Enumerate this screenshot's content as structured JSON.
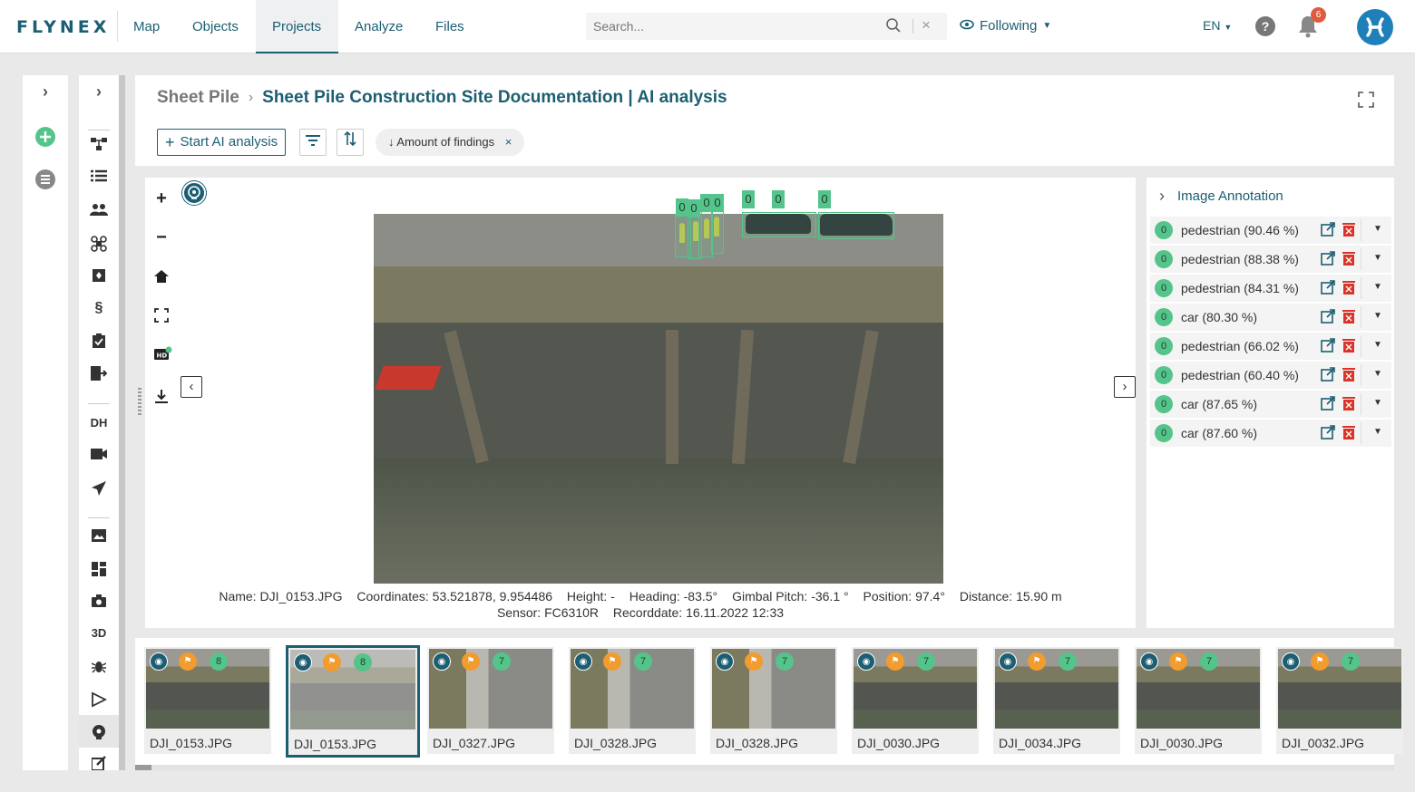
{
  "app": {
    "logo": "FLYNEX",
    "nav": [
      "Map",
      "Objects",
      "Projects",
      "Analyze",
      "Files"
    ],
    "active_nav": "Projects",
    "search": {
      "placeholder": "Search..."
    },
    "following_label": "Following",
    "language": "EN",
    "help": "?",
    "notifications_count": "6"
  },
  "rail2": {
    "dh": "DH",
    "threed": "3D",
    "section": "§"
  },
  "header": {
    "breadcrumb_parent": "Sheet Pile",
    "breadcrumb_current": "Sheet Pile Construction Site Documentation | AI analysis",
    "start_button": "Start AI analysis",
    "sort_chip": "Amount of findings",
    "sort_arrow": "↓"
  },
  "viewer": {
    "bbox_labels": [
      "0",
      "0",
      "0",
      "0",
      "0",
      "0",
      "0"
    ],
    "meta_line1": {
      "name": "Name: DJI_0153.JPG",
      "coordinates": "Coordinates: 53.521878, 9.954486",
      "height": "Height: -",
      "heading": "Heading: -83.5°",
      "gimbal": "Gimbal Pitch: -36.1 °",
      "position": "Position: 97.4°",
      "distance": "Distance: 15.90 m"
    },
    "meta_line2": {
      "sensor": "Sensor: FC6310R",
      "recorddate": "Recorddate: 16.11.2022 12:33"
    }
  },
  "annotations": {
    "title": "Image Annotation",
    "items": [
      {
        "badge": "0",
        "label": "pedestrian (90.46 %)"
      },
      {
        "badge": "0",
        "label": "pedestrian (88.38 %)"
      },
      {
        "badge": "0",
        "label": "pedestrian (84.31 %)"
      },
      {
        "badge": "0",
        "label": "car (80.30 %)"
      },
      {
        "badge": "0",
        "label": "pedestrian (66.02 %)"
      },
      {
        "badge": "0",
        "label": "pedestrian (60.40 %)"
      },
      {
        "badge": "0",
        "label": "car (87.65 %)"
      },
      {
        "badge": "0",
        "label": "car (87.60 %)"
      }
    ]
  },
  "filmstrip": [
    {
      "name": "DJI_0153.JPG",
      "count": "8",
      "scene": "wall"
    },
    {
      "name": "DJI_0153.JPG",
      "count": "8",
      "scene": "wall",
      "selected": true
    },
    {
      "name": "DJI_0327.JPG",
      "count": "7",
      "scene": "road"
    },
    {
      "name": "DJI_0328.JPG",
      "count": "7",
      "scene": "road"
    },
    {
      "name": "DJI_0328.JPG",
      "count": "7",
      "scene": "road"
    },
    {
      "name": "DJI_0030.JPG",
      "count": "7",
      "scene": "wall"
    },
    {
      "name": "DJI_0034.JPG",
      "count": "7",
      "scene": "wall"
    },
    {
      "name": "DJI_0030.JPG",
      "count": "7",
      "scene": "wall"
    },
    {
      "name": "DJI_0032.JPG",
      "count": "7",
      "scene": "wall"
    }
  ],
  "colors": {
    "brand": "#1c5e72",
    "detection": "#55c48a",
    "flag": "#f29b2e",
    "delete": "#d9342b"
  }
}
